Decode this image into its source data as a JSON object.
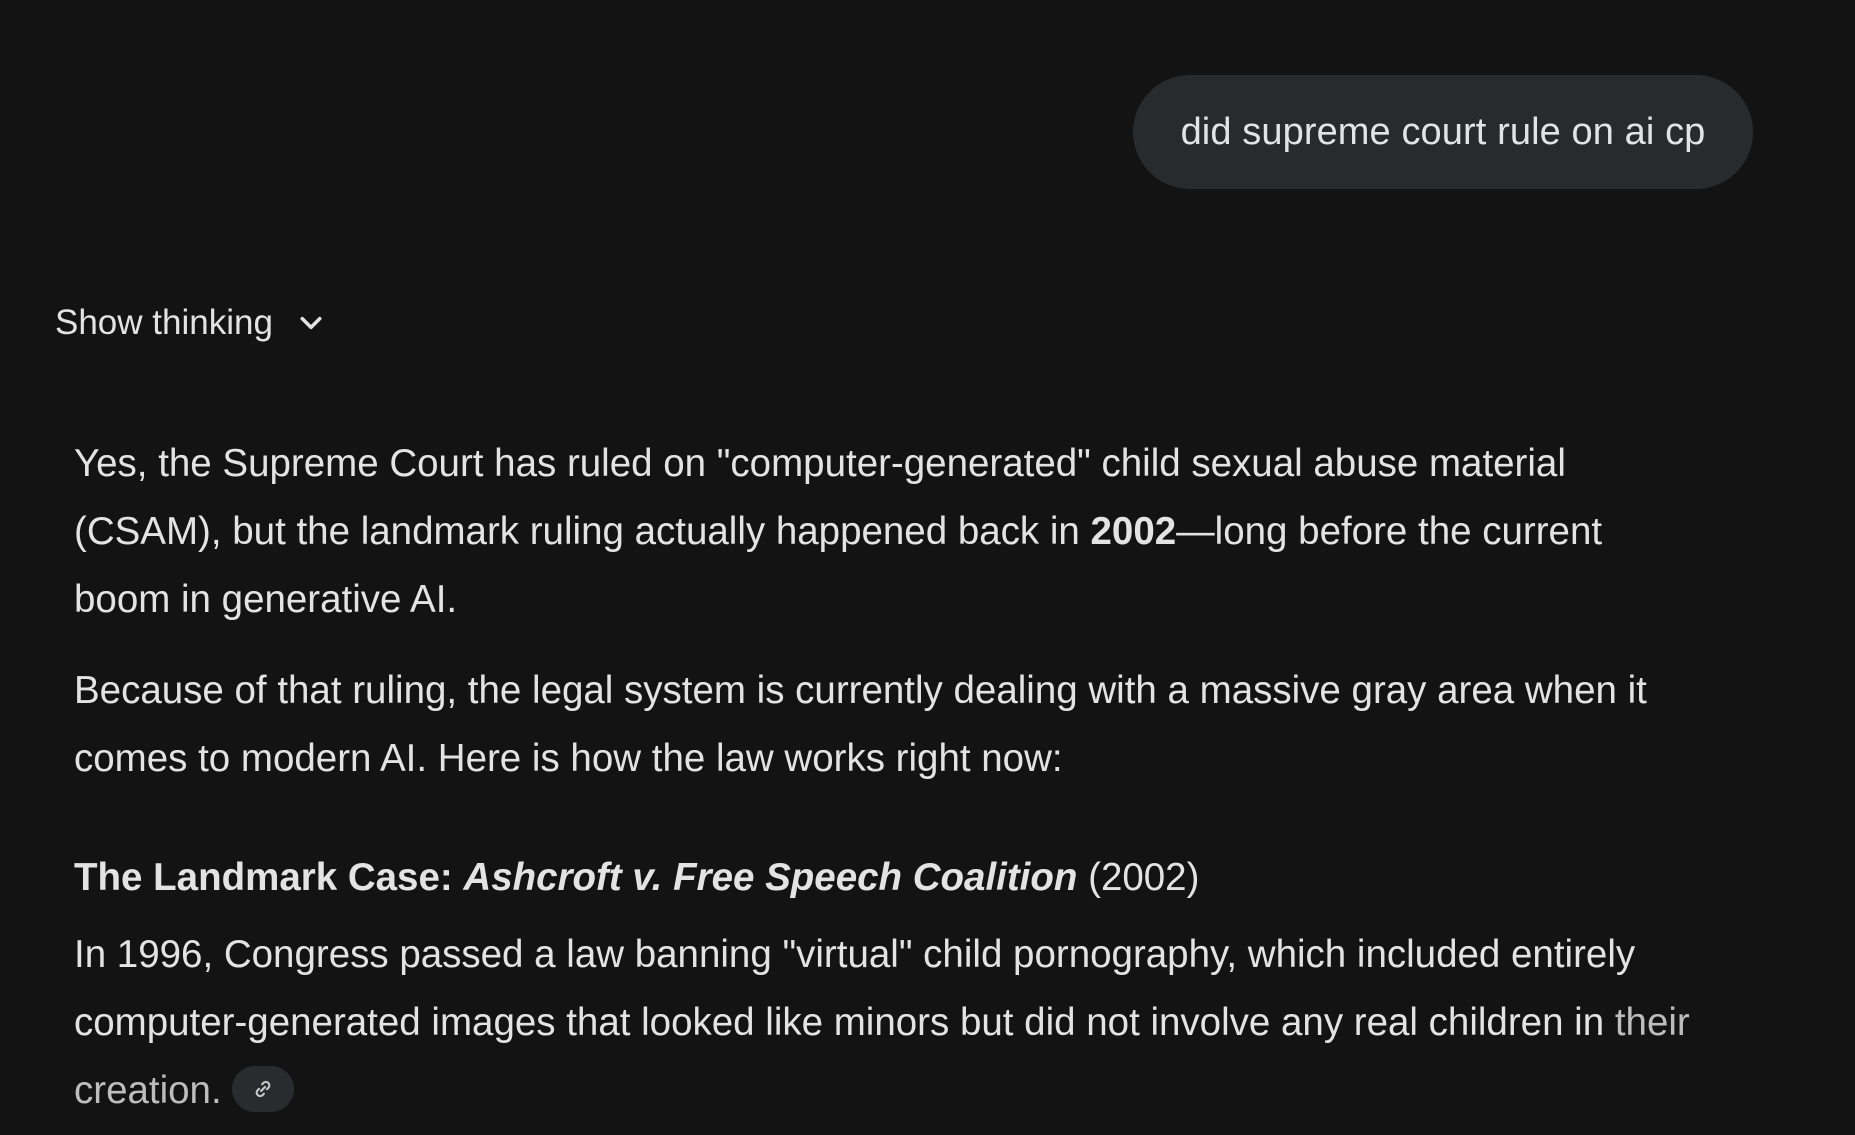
{
  "user_message": {
    "text": "did supreme court rule on ai cp"
  },
  "thinking_toggle": {
    "label": "Show thinking",
    "icon": "chevron-down-icon"
  },
  "response": {
    "paragraph_1": {
      "part_1": "Yes, the Supreme Court has ruled on \"computer-generated\" child sexual abuse material (CSAM), but the landmark ruling actually happened back in ",
      "bold": "2002",
      "part_2": "—long before the current boom in generative AI."
    },
    "paragraph_2": "Because of that ruling, the legal system is currently dealing with a massive gray area when it comes to modern AI. Here is how the law works right now:",
    "heading": {
      "prefix": "The Landmark Case: ",
      "case_name": "Ashcroft v. Free Speech Coalition",
      "suffix": " (2002)"
    },
    "paragraph_3": {
      "main": "In 1996, Congress passed a law banning \"virtual\" child pornography, which included entirely computer-generated images that looked like minors but did not involve any real children in ",
      "faded": "their creation.",
      "source_icon": "link-icon"
    }
  },
  "colors": {
    "background": "#131314",
    "bubble": "#282a2c",
    "text": "#e3e3e3",
    "chip": "#2a2b2e"
  }
}
